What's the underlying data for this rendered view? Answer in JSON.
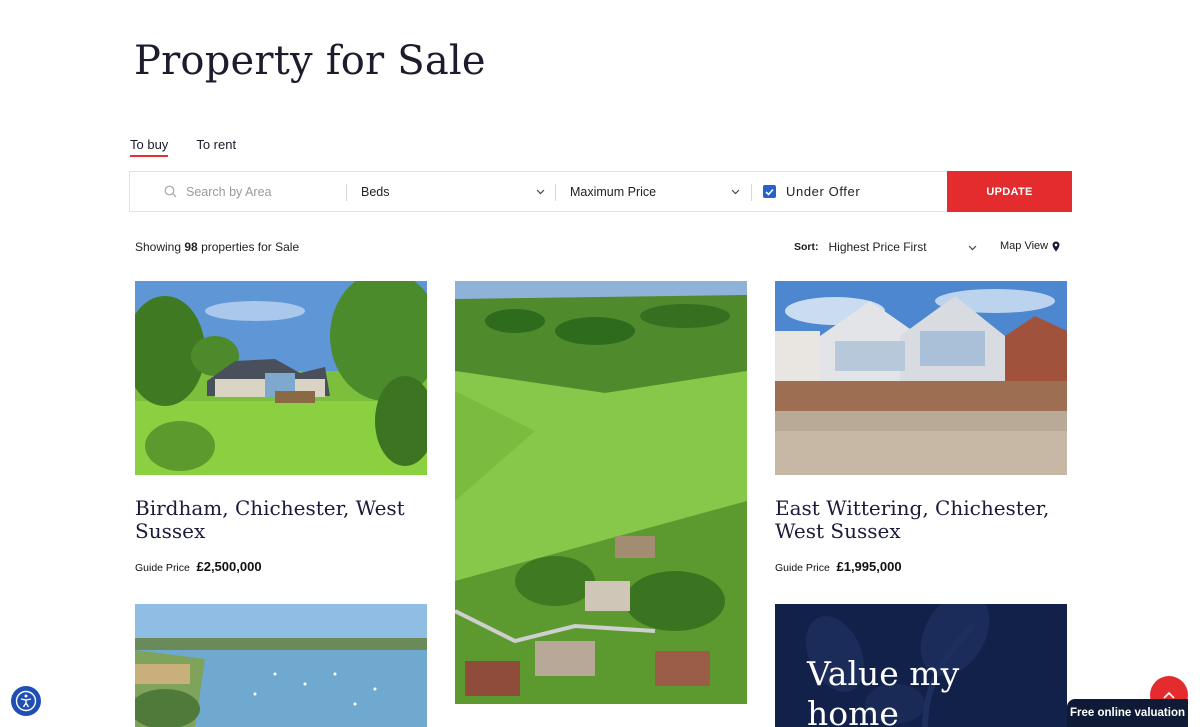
{
  "page": {
    "title": "Property for Sale"
  },
  "tabs": [
    {
      "label": "To buy",
      "active": true
    },
    {
      "label": "To rent",
      "active": false
    }
  ],
  "search": {
    "area_placeholder": "Search by Area",
    "beds_label": "Beds",
    "max_price_label": "Maximum Price",
    "under_offer_label": "Under Offer",
    "under_offer_checked": true,
    "update_label": "UPDATE"
  },
  "results": {
    "prefix": "Showing",
    "count": "98",
    "suffix": "properties for Sale"
  },
  "sort": {
    "label": "Sort:",
    "value": "Highest Price First"
  },
  "map_view": {
    "label": "Map View"
  },
  "listings": [
    {
      "title": "Birdham, Chichester, West Sussex",
      "price_label": "Guide Price",
      "price": "£2,500,000"
    },
    {
      "title": "East Wittering, Chichester, West Sussex",
      "price_label": "Guide Price",
      "price": "£1,995,000"
    }
  ],
  "valuation_card": {
    "title": "Value my home"
  },
  "floating": {
    "valuation_label": "Free online valuation"
  },
  "colors": {
    "accent": "#e42c2f",
    "navy": "#12214a",
    "check_blue": "#2563c9"
  },
  "icons": [
    "search-icon",
    "chevron-down-icon",
    "check-icon",
    "map-pin-icon",
    "arrow-up-icon",
    "accessibility-icon"
  ]
}
